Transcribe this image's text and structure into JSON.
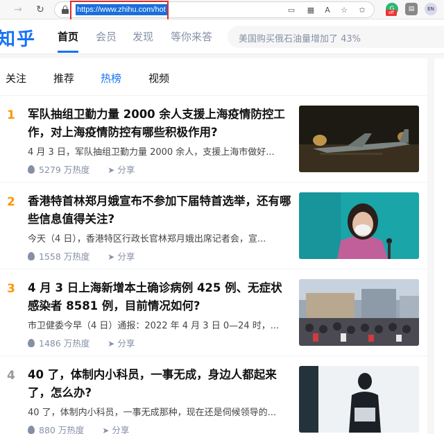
{
  "browser": {
    "url": "https://www.zhihu.com/hot",
    "ext_badge": "off",
    "ext_profile": "EN"
  },
  "header": {
    "logo": "知乎",
    "nav": [
      "首页",
      "会员",
      "发现",
      "等你来答"
    ],
    "search_placeholder": "美国购买俄石油量增加了 43%"
  },
  "tabs": [
    "关注",
    "推荐",
    "热榜",
    "视频"
  ],
  "active_tab": "热榜",
  "share_label": "分享",
  "hot_list": [
    {
      "rank": "1",
      "title": "军队抽组卫勤力量 2000 余人支援上海疫情防控工作，对上海疫情防控有哪些积极作用?",
      "excerpt": "4 月 3 日，军队抽组卫勤力量 2000 余人，支援上海市做好...",
      "heat": "5279 万热度"
    },
    {
      "rank": "2",
      "title": "香港特首林郑月娥宣布不参加下届特首选举，还有哪些信息值得关注?",
      "excerpt": "今天（4 日），香港特区行政长官林郑月娥出席记者会，宣...",
      "heat": "1558 万热度"
    },
    {
      "rank": "3",
      "title": "4 月 3 日上海新增本土确诊病例 425 例、无症状感染者 8581 例，目前情况如何?",
      "excerpt": "市卫健委今早（4 日）通报：2022 年 4 月 3 日 0—24 时，...",
      "heat": "1486 万热度"
    },
    {
      "rank": "4",
      "title": "40 了，体制内小科员，一事无成，身边人都起来了，怎么办?",
      "excerpt": "40 了，体制内小科员，一事无成那种，现在还是伺候领导的...",
      "heat": "880 万热度"
    }
  ]
}
